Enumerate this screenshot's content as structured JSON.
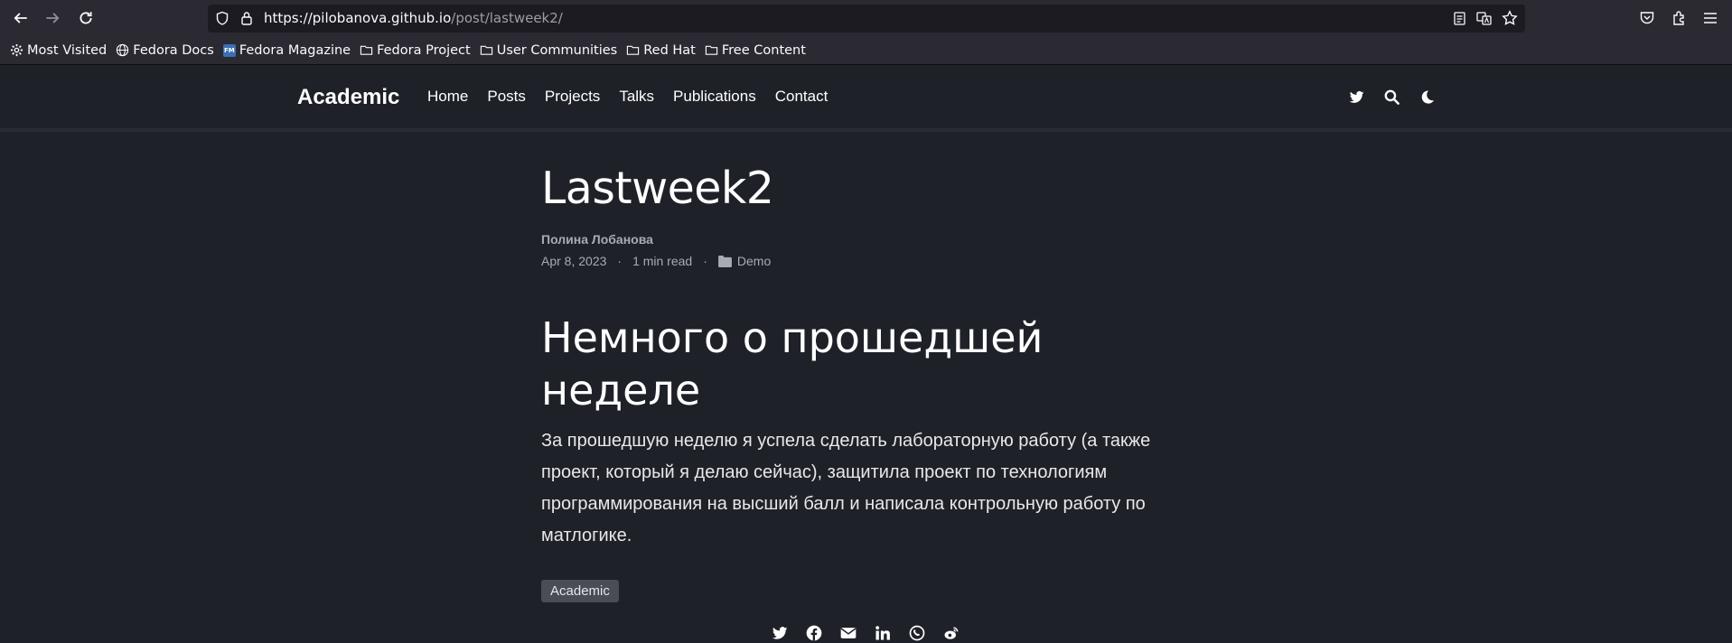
{
  "browser": {
    "url_host": "https://pilobanova.github.io",
    "url_path": "/post/lastweek2/",
    "bookmarks": [
      {
        "label": "Most Visited",
        "icon": "gear-icon"
      },
      {
        "label": "Fedora Docs",
        "icon": "globe-icon"
      },
      {
        "label": "Fedora Magazine",
        "icon": "fedora-magazine-icon"
      },
      {
        "label": "Fedora Project",
        "icon": "folder-icon"
      },
      {
        "label": "User Communities",
        "icon": "folder-icon"
      },
      {
        "label": "Red Hat",
        "icon": "folder-icon"
      },
      {
        "label": "Free Content",
        "icon": "folder-icon"
      }
    ],
    "fm_icon_text": "FM"
  },
  "site": {
    "brand": "Academic",
    "menu": [
      "Home",
      "Posts",
      "Projects",
      "Talks",
      "Publications",
      "Contact"
    ]
  },
  "post": {
    "title": "Lastweek2",
    "author": "Полина Лобанова",
    "date": "Apr 8, 2023",
    "read_time": "1 min read",
    "category": "Demo",
    "heading": "Немного о прошедшей неделе",
    "body": "За прошедшую неделю я успела сделать лабораторную работу (а также проект, который я делаю сейчас), защитила проект по технологиям программирования на высший балл и написала контрольную работу по матлогике.",
    "tag": "Academic",
    "meta_separator": "·"
  },
  "colors": {
    "background": "#1f2129",
    "chrome": "#2b2a33",
    "urlbar": "#1c1b22"
  }
}
